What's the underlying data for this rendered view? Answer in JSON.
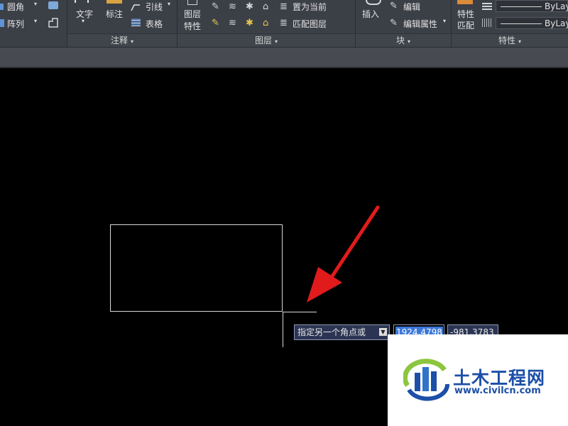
{
  "ribbon": {
    "modify": {
      "fillet": "圆角",
      "array": "阵列"
    },
    "annotation": {
      "text": "文字",
      "dimension": "标注",
      "leader": "引线",
      "table": "表格",
      "title": "注释"
    },
    "layers": {
      "properties_line1": "图层",
      "properties_line2": "特性",
      "set_current": "置为当前",
      "match_layer": "匹配图层",
      "title": "图层"
    },
    "block": {
      "insert": "插入",
      "edit": "编辑",
      "edit_attributes": "编辑属性",
      "title": "块"
    },
    "properties": {
      "match_line1": "特性",
      "match_line2": "匹配",
      "linetype": "ByLay",
      "lineweight": "ByLay",
      "title": "特性"
    }
  },
  "canvas": {
    "prompt": "指定另一个角点或",
    "x_value": "1924.4798",
    "y_value": "-981.3783"
  },
  "watermark": {
    "name": "土木工程网",
    "url": "www.civilcn.com"
  },
  "colors": {
    "ribbon_bg": "#3b3f46",
    "canvas_bg": "#000000",
    "arrow": "#e11b1b",
    "selection": "#3c78d8",
    "watermark_blue": "#1c4fa8"
  }
}
